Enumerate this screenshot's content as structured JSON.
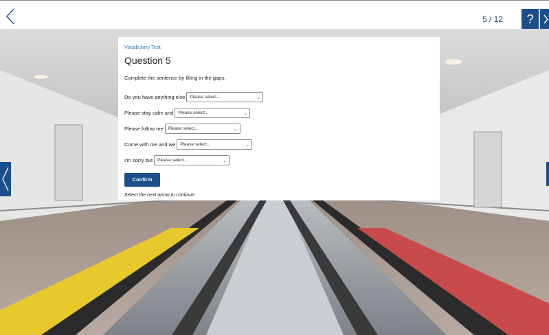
{
  "topbar": {
    "progress": "5 / 12",
    "help_label": "?",
    "back_icon": "chevron-left-icon",
    "next_icon": "chevron-right-icon"
  },
  "panel": {
    "subtitle": "Vocabulary Test",
    "title": "Question 5",
    "instruction": "Complete the sentence by filling in the gaps.",
    "rows": [
      {
        "label": "Do you have anything else",
        "placeholder": "Please select..."
      },
      {
        "label": "Please stay calm and",
        "placeholder": "Please select..."
      },
      {
        "label": "Please follow me",
        "placeholder": "Please select..."
      },
      {
        "label": "Come with me and we",
        "placeholder": "Please select..."
      },
      {
        "label": "I'm sorry but",
        "placeholder": "Please select..."
      }
    ],
    "confirm_label": "Confirm",
    "footnote": "Select the next arrow to continue."
  },
  "colors": {
    "accent": "#1b4e8b",
    "subtitle": "#1e6fb5"
  }
}
